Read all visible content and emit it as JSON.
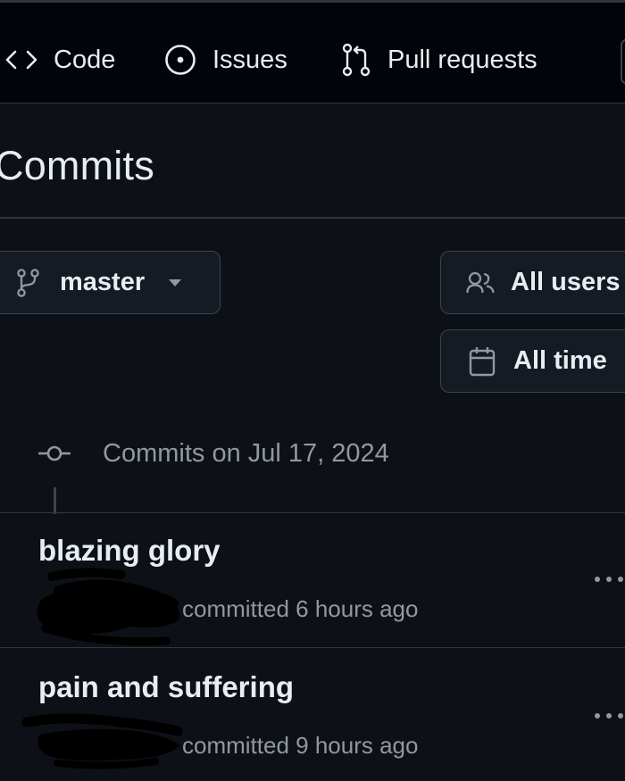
{
  "nav": {
    "tabs": [
      {
        "label": "Code",
        "icon": "code-icon"
      },
      {
        "label": "Issues",
        "icon": "issue-opened-icon"
      },
      {
        "label": "Pull requests",
        "icon": "git-pull-request-icon"
      }
    ]
  },
  "page": {
    "title": "Commits"
  },
  "filters": {
    "branch": {
      "label": "master",
      "icon": "git-branch-icon"
    },
    "users": {
      "label": "All users",
      "icon": "people-icon"
    },
    "time": {
      "label": "All time",
      "icon": "calendar-icon"
    }
  },
  "commit_groups": [
    {
      "title": "Commits on Jul 17, 2024",
      "commits": [
        {
          "message": "blazing glory",
          "meta": "committed 6 hours ago"
        },
        {
          "message": "pain and suffering",
          "meta": "committed 9 hours ago"
        }
      ]
    }
  ],
  "colors": {
    "background": "#0d1117",
    "header": "#010409",
    "border": "#30363d",
    "text": "#e6edf3",
    "muted": "#9198a1"
  }
}
